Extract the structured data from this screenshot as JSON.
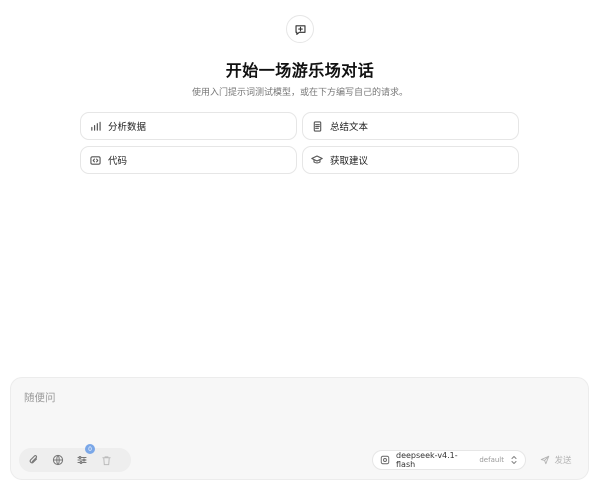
{
  "hero": {
    "icon": "chat-plus-icon"
  },
  "title": "开始一场游乐场对话",
  "subtitle": "使用入门提示词测试模型，或在下方编写自己的请求。",
  "suggestions": [
    {
      "label": "分析数据",
      "icon": "bar-chart-icon"
    },
    {
      "label": "总结文本",
      "icon": "document-icon"
    },
    {
      "label": "代码",
      "icon": "code-icon"
    },
    {
      "label": "获取建议",
      "icon": "graduation-cap-icon"
    }
  ],
  "composer": {
    "placeholder": "随便问",
    "tools": {
      "attach_icon": "paperclip-icon",
      "web_icon": "globe-icon",
      "settings_icon": "sliders-icon",
      "settings_badge": "0",
      "delete_icon": "trash-icon"
    },
    "model": {
      "name": "deepseek-v4.1-flash",
      "tag": "default",
      "icon": "model-icon"
    },
    "send_label": "发送",
    "colors": {
      "badge": "#7aa7e8",
      "send_disabled": "#b3b3b3"
    }
  }
}
